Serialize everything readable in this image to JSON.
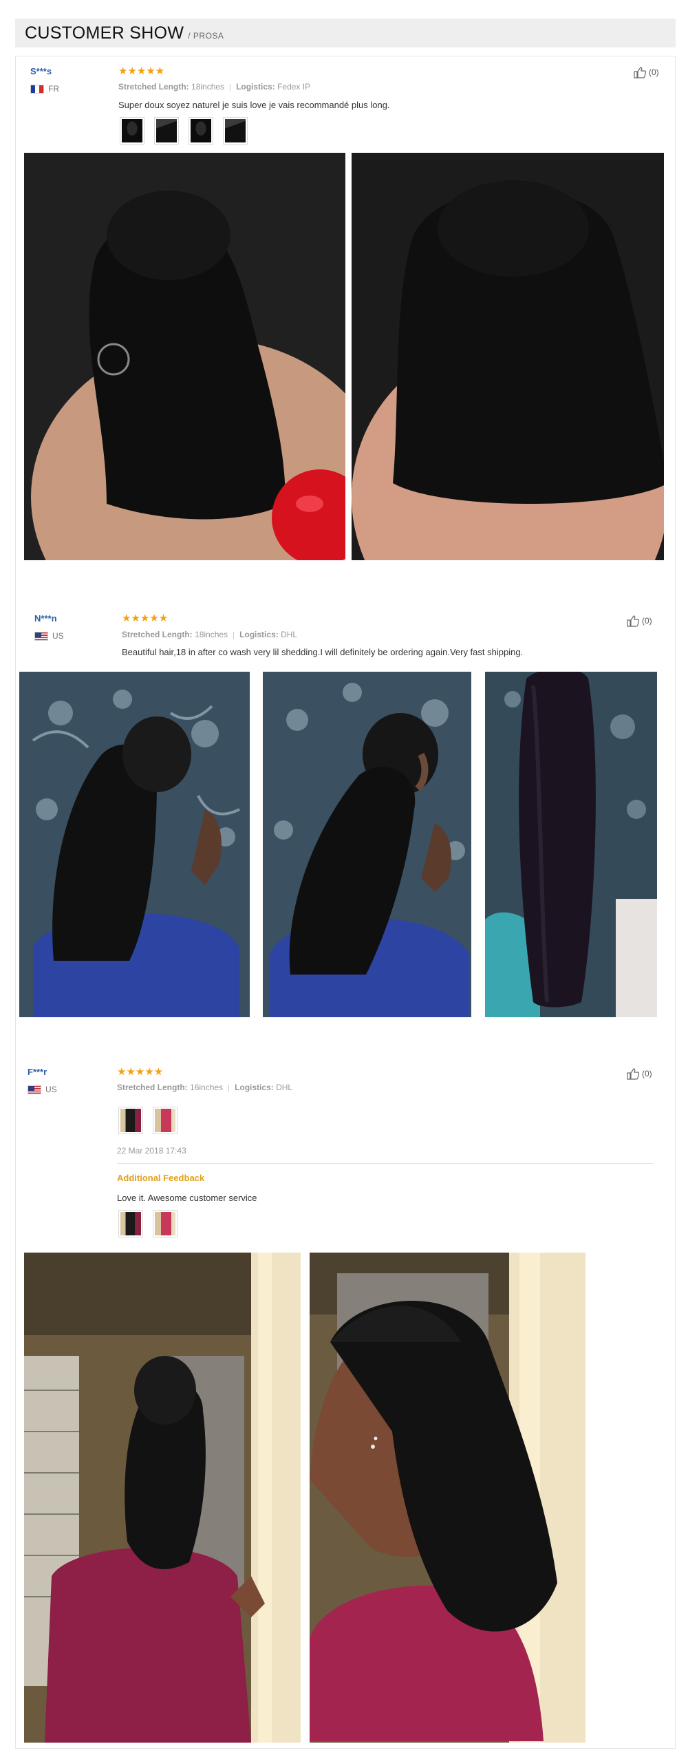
{
  "header": {
    "title": "CUSTOMER SHOW",
    "subtitle": "/ PROSA"
  },
  "reviews": [
    {
      "user": "S***s",
      "country": "FR",
      "rating": "★★★★★",
      "stretched_length_label": "Stretched Length:",
      "stretched_length": "18inches",
      "logistics_label": "Logistics:",
      "logistics": "Fedex IP",
      "text": "Super doux soyez naturel je suis love je vais recommandé plus long.",
      "likes": "(0)",
      "thumbnail_icons": [
        "photo-thumb",
        "photo-thumb",
        "photo-thumb",
        "photo-thumb"
      ]
    },
    {
      "user": "N***n",
      "country": "US",
      "rating": "★★★★★",
      "stretched_length_label": "Stretched Length:",
      "stretched_length": "18inches",
      "logistics_label": "Logistics:",
      "logistics": "DHL",
      "text": "Beautiful hair,18 in after co wash very lil shedding.I will definitely be ordering again.Very fast shipping.",
      "likes": "(0)"
    },
    {
      "user": "F***r",
      "country": "US",
      "rating": "★★★★★",
      "stretched_length_label": "Stretched Length:",
      "stretched_length": "16inches",
      "logistics_label": "Logistics:",
      "logistics": "DHL",
      "date": "22 Mar 2018 17:43",
      "additional_label": "Additional Feedback",
      "additional_text": "Love it. Awesome customer service",
      "likes": "(0)"
    }
  ],
  "colors": {
    "accent_star": "#f3a110",
    "user_link": "#2b5ea8",
    "additional": "#e4a017"
  }
}
